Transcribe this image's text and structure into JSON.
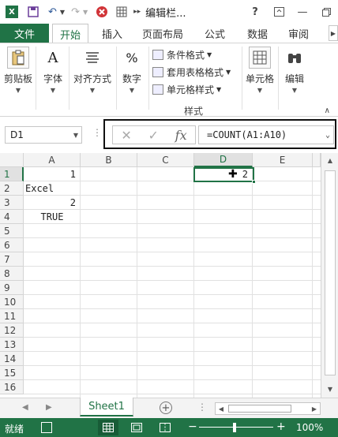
{
  "titlebar": {
    "app_logo": "X",
    "title": "编辑栏...",
    "help": "?",
    "icons": [
      "excel-logo-icon",
      "save-icon",
      "undo-icon",
      "redo-icon",
      "close-circle-icon",
      "table-icon",
      "more-icon"
    ]
  },
  "tabs": {
    "file": "文件",
    "items": [
      "开始",
      "插入",
      "页面布局",
      "公式",
      "数据",
      "审阅"
    ],
    "active": "开始"
  },
  "ribbon": {
    "clipboard": "剪贴板",
    "font": "字体",
    "alignment": "对齐方式",
    "number": "数字",
    "number_icon": "%",
    "conditional_format": "条件格式",
    "format_as_table": "套用表格格式",
    "cell_styles": "单元格样式",
    "styles_group": "样式",
    "cells": "单元格",
    "editing": "编辑"
  },
  "formula_bar": {
    "name_box": "D1",
    "formula": "=COUNT(A1:A10)",
    "fx": "fx"
  },
  "grid": {
    "columns": [
      "A",
      "B",
      "C",
      "D",
      "E"
    ],
    "rows": [
      "1",
      "2",
      "3",
      "4",
      "5",
      "6",
      "7",
      "8",
      "9",
      "10",
      "11",
      "12",
      "13",
      "14",
      "15",
      "16"
    ],
    "selected_column": "D",
    "selected_row": "1",
    "cells": {
      "A1": "1",
      "A2": "Excel",
      "A3": "2",
      "A4": "TRUE",
      "D1": "2"
    }
  },
  "sheets": {
    "tabs": [
      "Sheet1"
    ],
    "active": "Sheet1",
    "add": "⊕"
  },
  "status": {
    "text": "就绪",
    "zoom": "100%",
    "minus": "−",
    "plus": "+"
  },
  "colors": {
    "accent": "#217346",
    "status_bg": "#217346"
  }
}
